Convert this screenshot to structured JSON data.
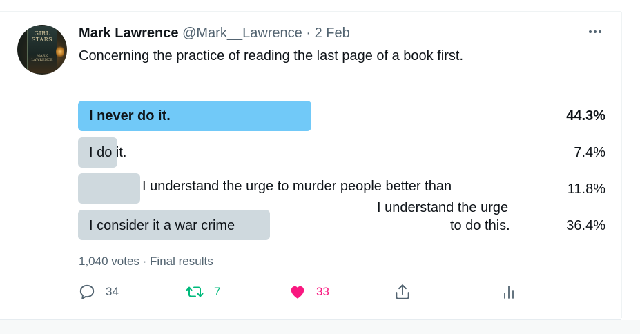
{
  "tweet": {
    "author_name": "Mark Lawrence",
    "handle": "@Mark__Lawrence",
    "separator": "·",
    "date": "2 Feb",
    "text": "Concerning the practice of reading the last page of a book first.",
    "more_icon": "more-horizontal-icon",
    "avatar": {
      "book_title_line1": "GIRL",
      "book_title_line2": "STARS",
      "book_author_line1": "MARK",
      "book_author_line2": "LAWRENCE"
    }
  },
  "poll": {
    "options": [
      {
        "label": "I never do it.",
        "percent": "44.3%",
        "value": 44.3,
        "winner": true
      },
      {
        "label": "I  do it.",
        "percent": "7.4%",
        "value": 7.4,
        "winner": false
      },
      {
        "label": "I understand the urge to murder people better than",
        "percent": "11.8%",
        "value": 11.8,
        "winner": false
      },
      {
        "label": "I consider it a war crime",
        "percent": "36.4%",
        "value": 36.4,
        "winner": false
      }
    ],
    "overlay_note_line1": "I understand the urge",
    "overlay_note_line2": "to do this.",
    "votes": "1,040 votes",
    "meta_separator": "·",
    "status": "Final results",
    "colors": {
      "winner_bar": "#71c9f8",
      "other_bar": "#cfd9de"
    }
  },
  "actions": {
    "reply_count": "34",
    "retweet_count": "7",
    "like_count": "33",
    "reply_icon": "reply-icon",
    "retweet_icon": "retweet-icon",
    "like_icon": "heart-icon",
    "share_icon": "share-icon",
    "stats_icon": "analytics-icon",
    "colors": {
      "retweet": "#00ba7c",
      "like": "#f91880",
      "muted": "#536471"
    }
  }
}
